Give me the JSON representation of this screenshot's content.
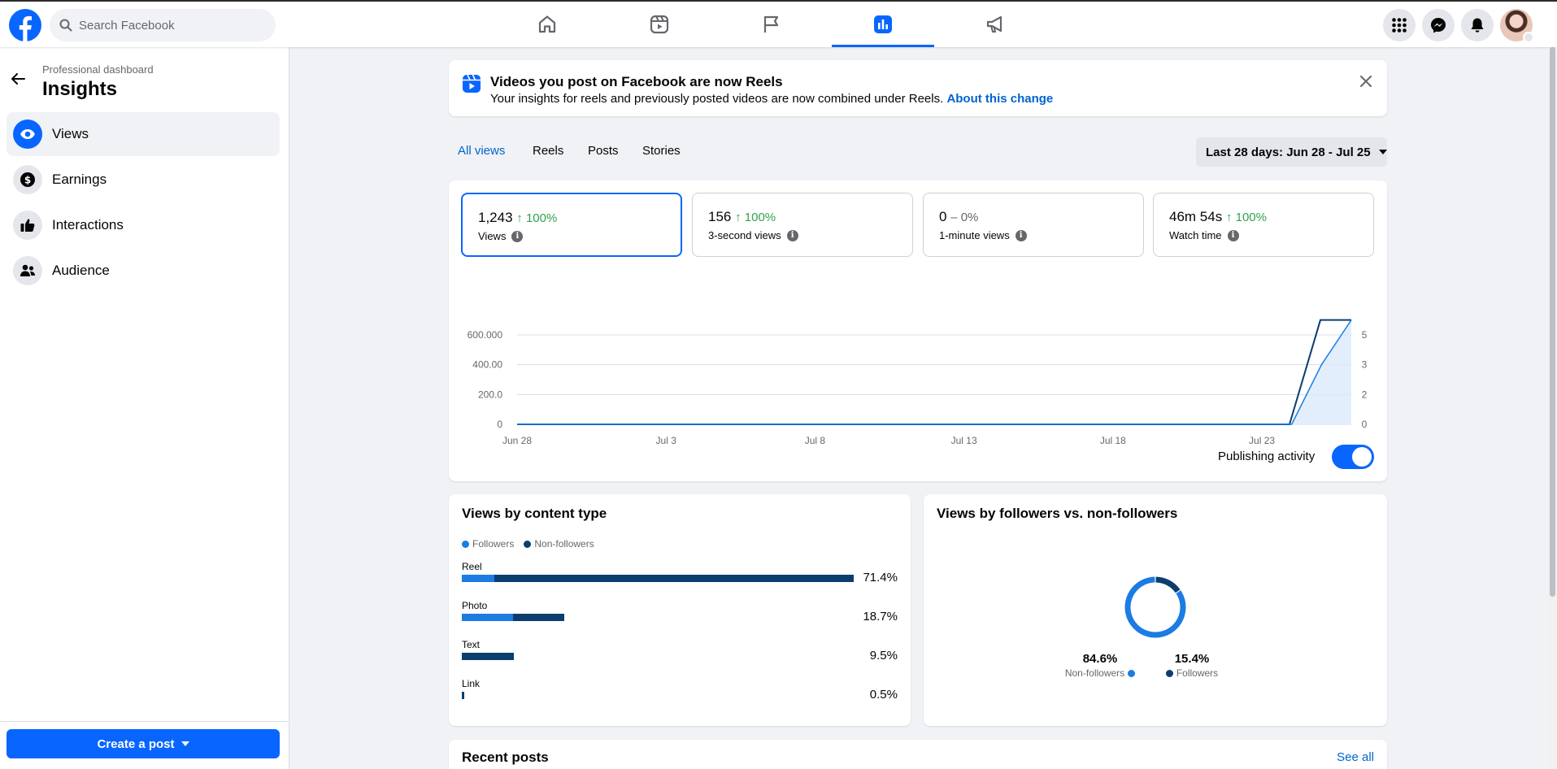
{
  "topbar": {
    "search_placeholder": "Search Facebook",
    "nav_icons": [
      "home-icon",
      "reels-icon",
      "pages-flag-icon",
      "insights-chart-icon",
      "ads-megaphone-icon"
    ],
    "active_nav": "insights-chart-icon",
    "right_icons": [
      "menu-grid-icon",
      "messenger-icon",
      "notifications-bell-icon"
    ]
  },
  "sidebar": {
    "breadcrumb": "Professional dashboard",
    "title": "Insights",
    "items": [
      {
        "label": "Views",
        "icon": "eye-icon",
        "active": true
      },
      {
        "label": "Earnings",
        "icon": "dollar-icon",
        "active": false
      },
      {
        "label": "Interactions",
        "icon": "thumbs-up-icon",
        "active": false
      },
      {
        "label": "Audience",
        "icon": "people-icon",
        "active": false
      }
    ],
    "create_post_label": "Create a post"
  },
  "banner": {
    "title": "Videos you post on Facebook are now Reels",
    "subtitle": "Your insights for reels and previously posted videos are now combined under Reels.",
    "link": "About this change"
  },
  "subtabs": [
    {
      "label": "All views",
      "active": true
    },
    {
      "label": "Reels",
      "active": false
    },
    {
      "label": "Posts",
      "active": false
    },
    {
      "label": "Stories",
      "active": false
    }
  ],
  "date_range": "Last 28 days: Jun 28 - Jul 25",
  "metrics": [
    {
      "value": "1,243",
      "change": "↑ 100%",
      "label": "Views",
      "active": true
    },
    {
      "value": "156",
      "change": "↑ 100%",
      "label": "3-second views",
      "active": false
    },
    {
      "value": "0",
      "change": "– 0%",
      "label": "1-minute views",
      "active": false
    },
    {
      "value": "46m 54s",
      "change": "↑ 100%",
      "label": "Watch time",
      "active": false
    }
  ],
  "publishing_activity_label": "Publishing activity",
  "publishing_activity_on": true,
  "chart_data": {
    "type": "line",
    "x": [
      "Jun 28",
      "Jul 3",
      "Jul 8",
      "Jul 13",
      "Jul 18",
      "Jul 23"
    ],
    "x_days_total": 28,
    "y_left_ticks": [
      "0",
      "200.0",
      "400.00",
      "600.000"
    ],
    "y_right_ticks": [
      "0",
      "2",
      "3",
      "5"
    ],
    "ylim_left": [
      0,
      600
    ],
    "series": [
      {
        "values": [
          0,
          0,
          0,
          0,
          0,
          0,
          0,
          0,
          0,
          0,
          0,
          0,
          0,
          0,
          0,
          0,
          0,
          0,
          0,
          0,
          0,
          0,
          0,
          0,
          0,
          0,
          700,
          700
        ],
        "color": "#0b3d6e",
        "area": false
      },
      {
        "values": [
          0,
          0,
          0,
          0,
          0,
          0,
          0,
          0,
          0,
          0,
          0,
          0,
          0,
          0,
          0,
          0,
          0,
          0,
          0,
          0,
          0,
          0,
          0,
          0,
          0,
          0,
          0,
          400,
          700
        ],
        "color": "#1b7ce3",
        "area": true
      }
    ],
    "grid": true
  },
  "content_type": {
    "title": "Views by content type",
    "legend": [
      {
        "label": "Followers",
        "color": "#1b7ce3"
      },
      {
        "label": "Non-followers",
        "color": "#0b3d6e"
      }
    ],
    "rows": [
      {
        "label": "Reel",
        "followers": 0.084,
        "nonfollowers": 0.916,
        "pct": "71.4%",
        "total": 71.4
      },
      {
        "label": "Photo",
        "followers": 0.5,
        "nonfollowers": 0.5,
        "pct": "18.7%",
        "total": 18.7
      },
      {
        "label": "Text",
        "followers": 0.0,
        "nonfollowers": 1.0,
        "pct": "9.5%",
        "total": 9.5
      },
      {
        "label": "Link",
        "followers": 0.0,
        "nonfollowers": 1.0,
        "pct": "0.5%",
        "total": 0.5
      }
    ]
  },
  "followers_split": {
    "title": "Views by followers vs. non-followers",
    "slices": [
      {
        "label": "Non-followers",
        "value": 84.6,
        "pct": "84.6%",
        "color": "#1b7ce3"
      },
      {
        "label": "Followers",
        "value": 15.4,
        "pct": "15.4%",
        "color": "#0b3d6e"
      }
    ]
  },
  "recent_posts": {
    "title": "Recent posts",
    "see_all": "See all"
  }
}
